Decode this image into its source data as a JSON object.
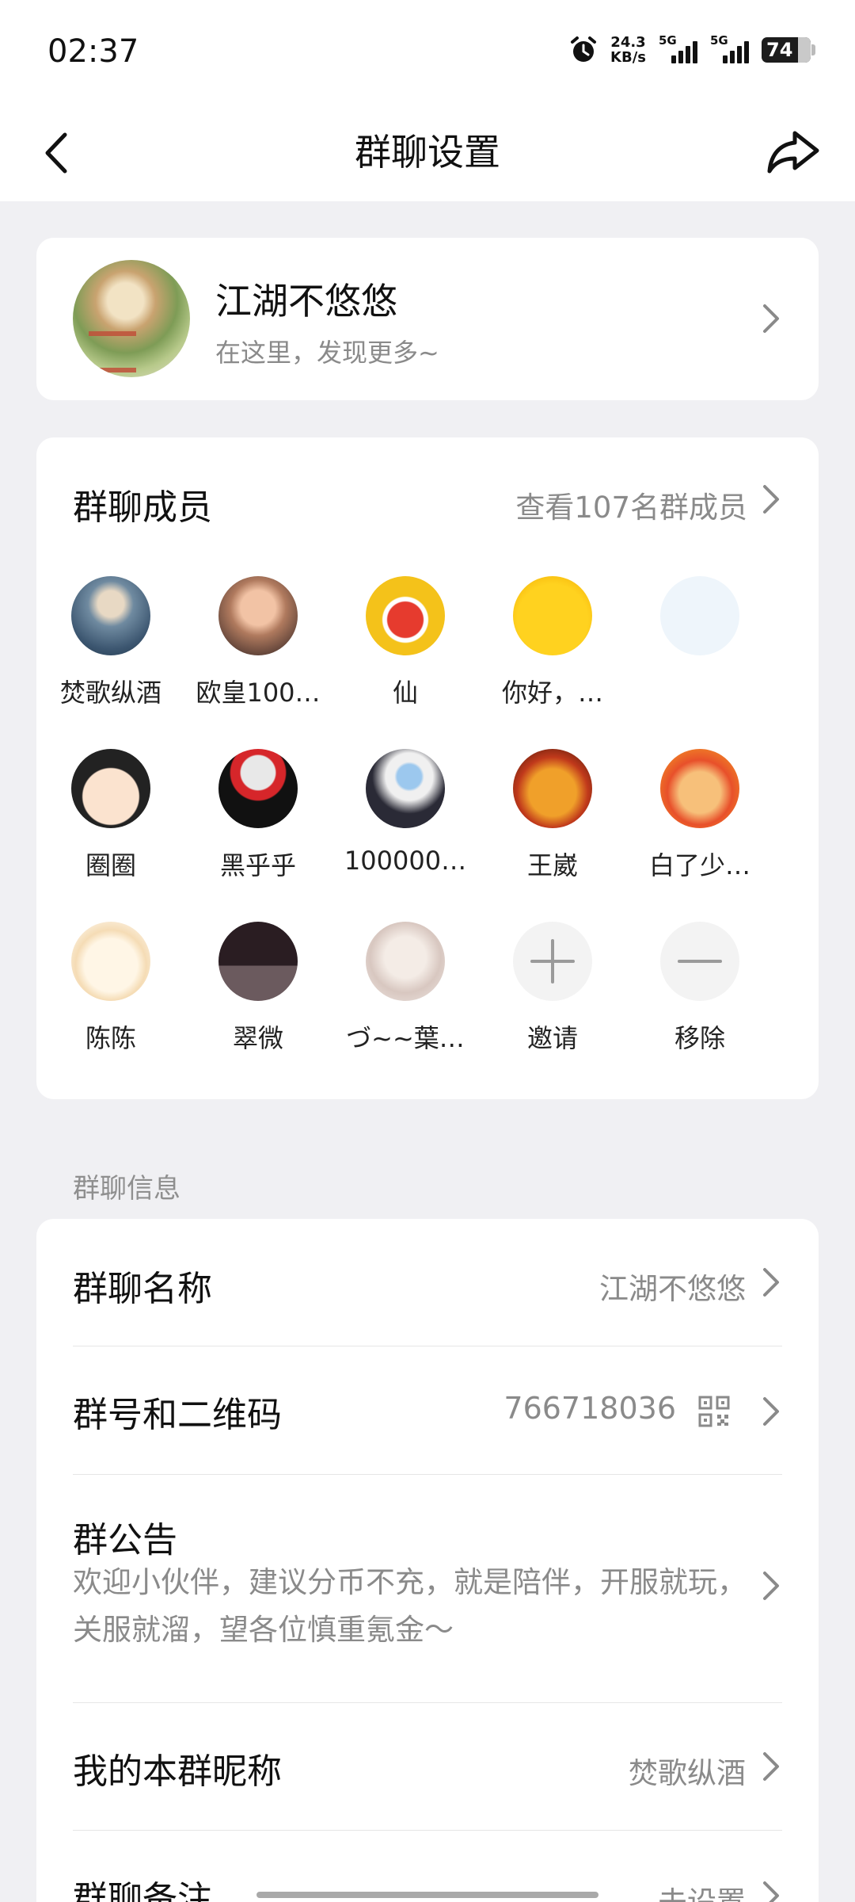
{
  "status_bar": {
    "time": "02:37",
    "net_speed_value": "24.3",
    "net_speed_unit": "KB/s",
    "signal1_label": "5G",
    "signal2_label": "5G",
    "battery": "74"
  },
  "header": {
    "title": "群聊设置"
  },
  "group": {
    "name": "江湖不悠悠",
    "subtitle": "在这里，发现更多~"
  },
  "members": {
    "title": "群聊成员",
    "view_all": "查看107名群成员",
    "list": [
      {
        "name": "焚歌纵酒",
        "avatar": "avatar-ink-warrior"
      },
      {
        "name": "欧皇100…",
        "avatar": "avatar-baby-photo"
      },
      {
        "name": "仙",
        "avatar": "avatar-red-fox-no1"
      },
      {
        "name": "你好，…",
        "avatar": "avatar-yellow-cat"
      },
      {
        "name": "",
        "avatar": "avatar-blank"
      },
      {
        "name": "圈圈",
        "avatar": "avatar-glasses-boy"
      },
      {
        "name": "黑乎乎",
        "avatar": "avatar-black-penguin"
      },
      {
        "name": "100000…",
        "avatar": "avatar-doraemon-photo"
      },
      {
        "name": "王崴",
        "avatar": "avatar-laughing-lion"
      },
      {
        "name": "白了少…",
        "avatar": "avatar-monkey-king"
      },
      {
        "name": "陈陈",
        "avatar": "avatar-bunny"
      },
      {
        "name": "翠微",
        "avatar": "avatar-dark-anime"
      },
      {
        "name": "づ~~葉…",
        "avatar": "avatar-pastel-anime"
      },
      {
        "name": "邀请",
        "avatar": "plus-icon"
      },
      {
        "name": "移除",
        "avatar": "minus-icon"
      }
    ]
  },
  "info": {
    "section_label": "群聊信息",
    "group_name_label": "群聊名称",
    "group_name_value": "江湖不悠悠",
    "group_id_label": "群号和二维码",
    "group_id_value": "766718036",
    "notice_label": "群公告",
    "notice_text": "欢迎小伙伴，建议分币不充，就是陪伴，开服就玩，关服就溜，望各位慎重氪金～",
    "nickname_label": "我的本群昵称",
    "nickname_value": "焚歌纵酒",
    "remark_label": "群聊备注",
    "remark_value": "未设置"
  },
  "colors": {
    "background": "#f0f0f3",
    "card": "#ffffff",
    "muted_text": "#8a8a8a"
  }
}
